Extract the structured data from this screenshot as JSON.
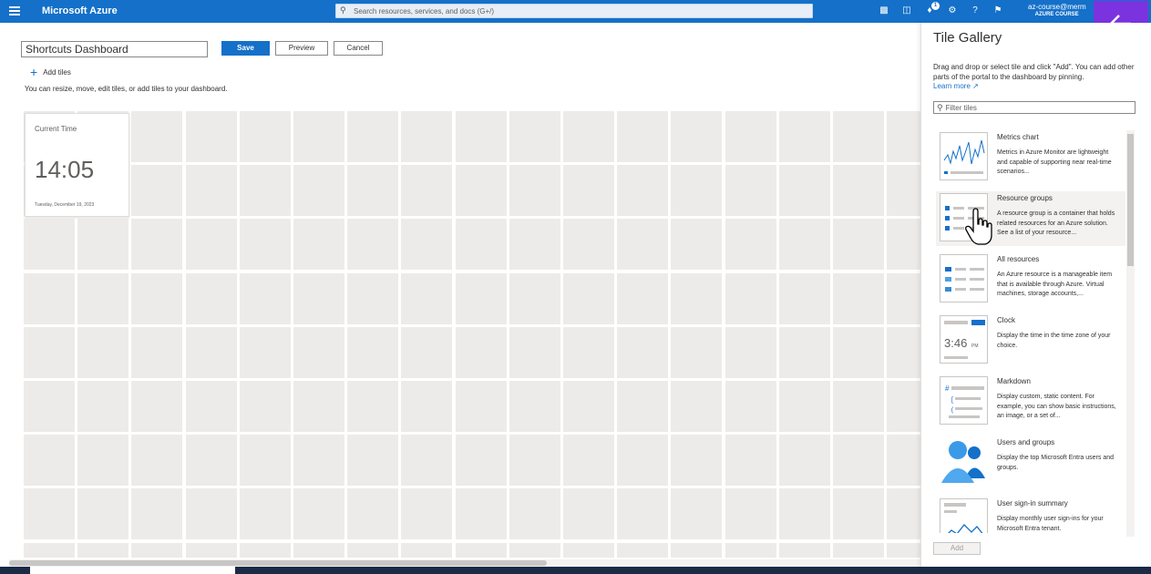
{
  "topbar": {
    "brand": "Microsoft Azure",
    "search_placeholder": "Search resources, services, and docs (G+/)",
    "notification_count": "1",
    "account_email": "az-course@merm",
    "account_tenant": "AZURE COURSE"
  },
  "editor": {
    "dashboard_title": "Shortcuts Dashboard",
    "save_label": "Save",
    "preview_label": "Preview",
    "cancel_label": "Cancel",
    "add_tiles_label": "Add tiles",
    "hint": "You can resize, move, edit tiles, or add tiles to your dashboard."
  },
  "clock_tile": {
    "label": "Current Time",
    "time": "14:05",
    "date": "Tuesday, December 19, 2023"
  },
  "gallery": {
    "title": "Tile Gallery",
    "description": "Drag and drop or select tile and click \"Add\". You can add other parts of the portal to the dashboard by pinning.",
    "learn_more": "Learn more",
    "filter_placeholder": "Filter tiles",
    "add_label": "Add",
    "items": [
      {
        "name": "Metrics chart",
        "description": "Metrics in Azure Monitor are lightweight and capable of supporting near real-time scenarios..."
      },
      {
        "name": "Resource groups",
        "description": "A resource group is a container that holds related resources for an Azure solution. See a list of your resource..."
      },
      {
        "name": "All resources",
        "description": "An Azure resource is a manageable item that is available through Azure. Virtual machines, storage accounts,..."
      },
      {
        "name": "Clock",
        "description": "Display the time in the time zone of your choice."
      },
      {
        "name": "Markdown",
        "description": "Display custom, static content. For example, you can show basic instructions, an image, or a set of..."
      },
      {
        "name": "Users and groups",
        "description": "Display the top Microsoft Entra users and groups."
      },
      {
        "name": "User sign-in summary",
        "description": "Display monthly user sign-ins for your Microsoft Entra tenant."
      }
    ],
    "clock_thumb_time": "3:46",
    "clock_thumb_ampm": "PM"
  },
  "colors": {
    "accent": "#1470c9",
    "back_button": "#7b33e0",
    "grid_cell": "#edebe9"
  }
}
